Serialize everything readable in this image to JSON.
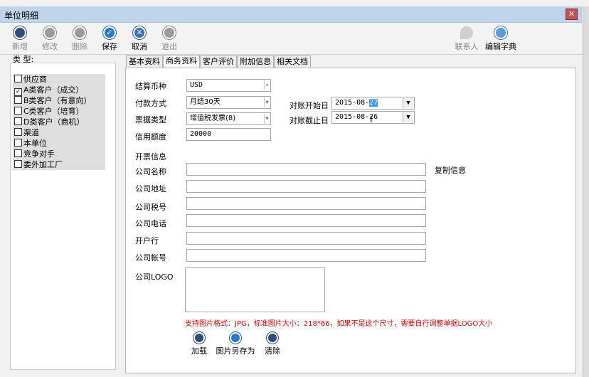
{
  "window": {
    "title": "单位明细",
    "close": "✕"
  },
  "toolbar": {
    "new": "新增",
    "edit": "修改",
    "delete": "删除",
    "save": "保存",
    "cancel": "取消",
    "exit": "退出",
    "contacts": "联系人",
    "dict": "编辑字典"
  },
  "categories": {
    "header": "类   型:",
    "items": [
      {
        "label": "供应商",
        "checked": false
      },
      {
        "label": "A类客户（成交）",
        "checked": true
      },
      {
        "label": "B类客户（有意向）",
        "checked": false
      },
      {
        "label": "C类客户（培育）",
        "checked": false
      },
      {
        "label": "D类客户（商机）",
        "checked": false
      },
      {
        "label": "渠道",
        "checked": false
      },
      {
        "label": "本单位",
        "checked": false
      },
      {
        "label": "竞争对手",
        "checked": false
      },
      {
        "label": "委外加工厂",
        "checked": false
      }
    ]
  },
  "tabs": [
    "基本资料",
    "商务资料",
    "客户评价",
    "附加信息",
    "相关文档"
  ],
  "form": {
    "currency_label": "结算币种",
    "currency_value": "USD",
    "payment_label": "付款方式",
    "payment_value": "月结30天",
    "invoice_type_label": "票据类型",
    "invoice_type_value": "增值税发票(8)",
    "credit_label": "信用额度",
    "credit_value": "20000",
    "start_label": "对账开始日",
    "start_value_prefix": "2015-08-",
    "start_value_sel": "27",
    "end_label": "对账截止日",
    "end_value": "2015-08-26",
    "invoice_info_label": "开票信息",
    "company_name_label": "公司名称",
    "company_address_label": "公司地址",
    "tax_no_label": "公司税号",
    "phone_label": "公司电话",
    "bank_label": "开户行",
    "account_label": "公司帐号",
    "logo_label": "公司LOGO",
    "copy_info": "复制信息",
    "logo_hint": "支持图片格式：JPG，标准图片大小：218*66，如果不是这个尺寸，需要自行调整单据LOGO大小",
    "load": "加载",
    "save_as": "图片另存为",
    "clear": "清除"
  }
}
